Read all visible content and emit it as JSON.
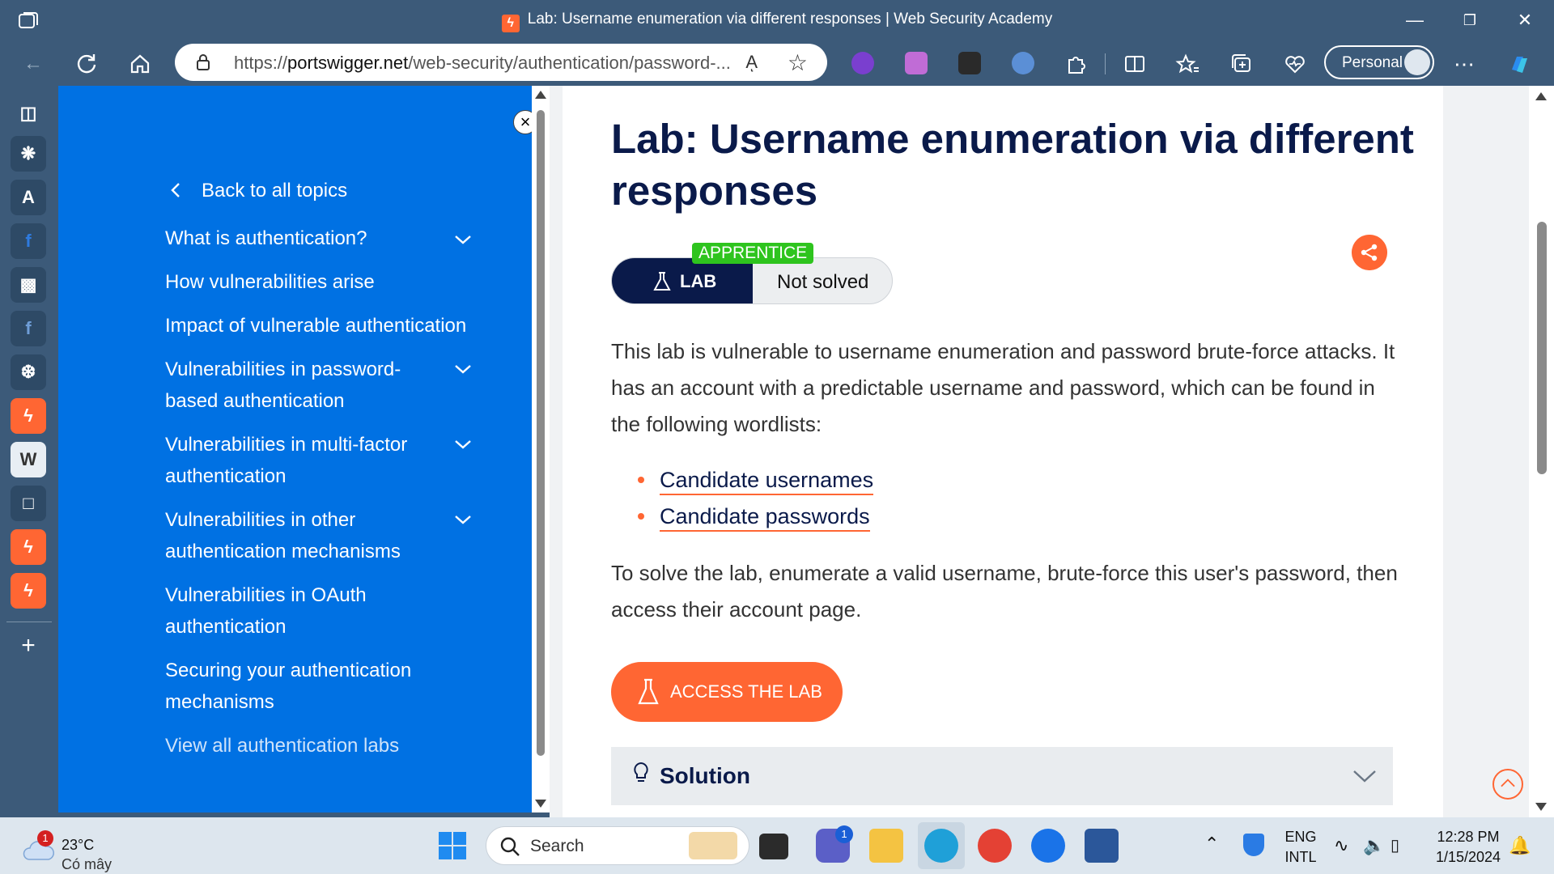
{
  "window": {
    "title": "Lab: Username enumeration via different responses | Web Security Academy",
    "minimize": "—",
    "restore": "❐",
    "close": "✕"
  },
  "toolbar": {
    "url_prefix": "https://",
    "url_domain": "portswigger.net",
    "url_path": "/web-security/authentication/password-...",
    "read_aloud": "Aͅ",
    "profile_label": "Personal"
  },
  "nav": {
    "back_label": "Back to all topics",
    "items": [
      {
        "label": "What is authentication?",
        "expandable": true
      },
      {
        "label": "How vulnerabilities arise",
        "expandable": false
      },
      {
        "label": "Impact of vulnerable authentication",
        "expandable": false
      },
      {
        "label": "Vulnerabilities in password-based authentication",
        "expandable": true
      },
      {
        "label": "Vulnerabilities in multi-factor authentication",
        "expandable": true
      },
      {
        "label": "Vulnerabilities in other authentication mechanisms",
        "expandable": true
      },
      {
        "label": "Vulnerabilities in OAuth authentication",
        "expandable": false
      },
      {
        "label": "Securing your authentication mechanisms",
        "expandable": false
      },
      {
        "label": "View all authentication labs",
        "expandable": false
      }
    ]
  },
  "lab": {
    "title": "Lab: Username enumeration via different responses",
    "level": "APPRENTICE",
    "badge_label": "LAB",
    "status": "Not solved",
    "intro": "This lab is vulnerable to username enumeration and password brute-force attacks. It has an account with a predictable username and password, which can be found in the following wordlists:",
    "wordlists": [
      "Candidate usernames",
      "Candidate passwords"
    ],
    "goal": "To solve the lab, enumerate a valid username, brute-force this user's password, then access their account page.",
    "access_button": "ACCESS THE LAB",
    "solution_label": "Solution"
  },
  "taskbar": {
    "weather_temp": "23°C",
    "weather_cond": "Có mây",
    "weather_badge": "1",
    "search_placeholder": "Search",
    "teams_badge": "1",
    "lang_line1": "ENG",
    "lang_line2": "INTL",
    "time": "12:28 PM",
    "date": "1/15/2024"
  },
  "colors": {
    "browser_chrome": "#3c5a79",
    "nav_blue": "#0071e3",
    "accent_orange": "#ff6633",
    "title_navy": "#0a1a4a",
    "level_green": "#2ec41e"
  }
}
